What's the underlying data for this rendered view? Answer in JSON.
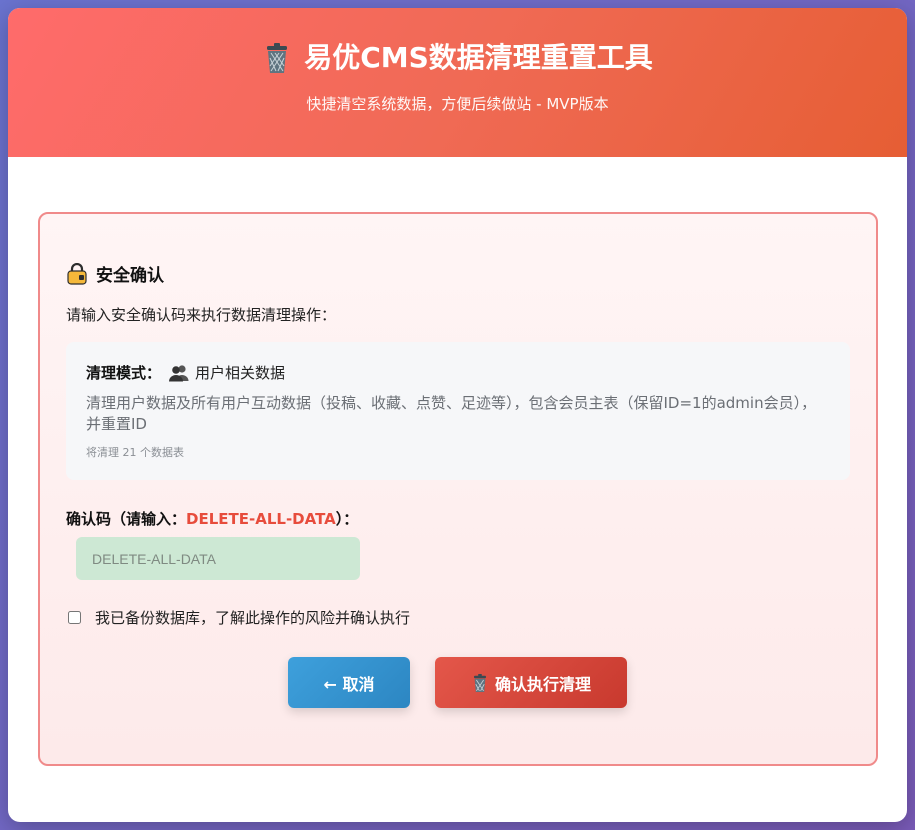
{
  "header": {
    "title": "易优CMS数据清理重置工具",
    "subtitle": "快捷清空系统数据，方便后续做站 - MVP版本",
    "icon": "trash-icon"
  },
  "security": {
    "title": "安全确认",
    "icon": "lock-icon",
    "intro": "请输入安全确认码来执行数据清理操作："
  },
  "mode": {
    "label": "清理模式：",
    "icon": "users-icon",
    "value": "用户相关数据",
    "description": "清理用户数据及所有用户互动数据（投稿、收藏、点赞、足迹等），包含会员主表（保留ID=1的admin会员），并重置ID",
    "table_count": "将清理 21 个数据表"
  },
  "code": {
    "label_prefix": "确认码（请输入：",
    "code": "DELETE-ALL-DATA",
    "label_suffix": "）：",
    "input_value": "",
    "input_placeholder": "DELETE-ALL-DATA"
  },
  "confirm": {
    "checkbox_label": "我已备份数据库，了解此操作的风险并确认执行",
    "checked": false
  },
  "buttons": {
    "cancel_label": "← 取消",
    "confirm_label": "确认执行清理",
    "confirm_icon": "trash-icon"
  },
  "colors": {
    "header_start": "#ff6b6b",
    "header_end": "#e65e34",
    "panel_border": "#f08a8a",
    "highlight": "#e74c3c",
    "cancel_button": "#3a96d4",
    "confirm_button": "#d84a3e",
    "input_bg": "#cde8d4"
  }
}
